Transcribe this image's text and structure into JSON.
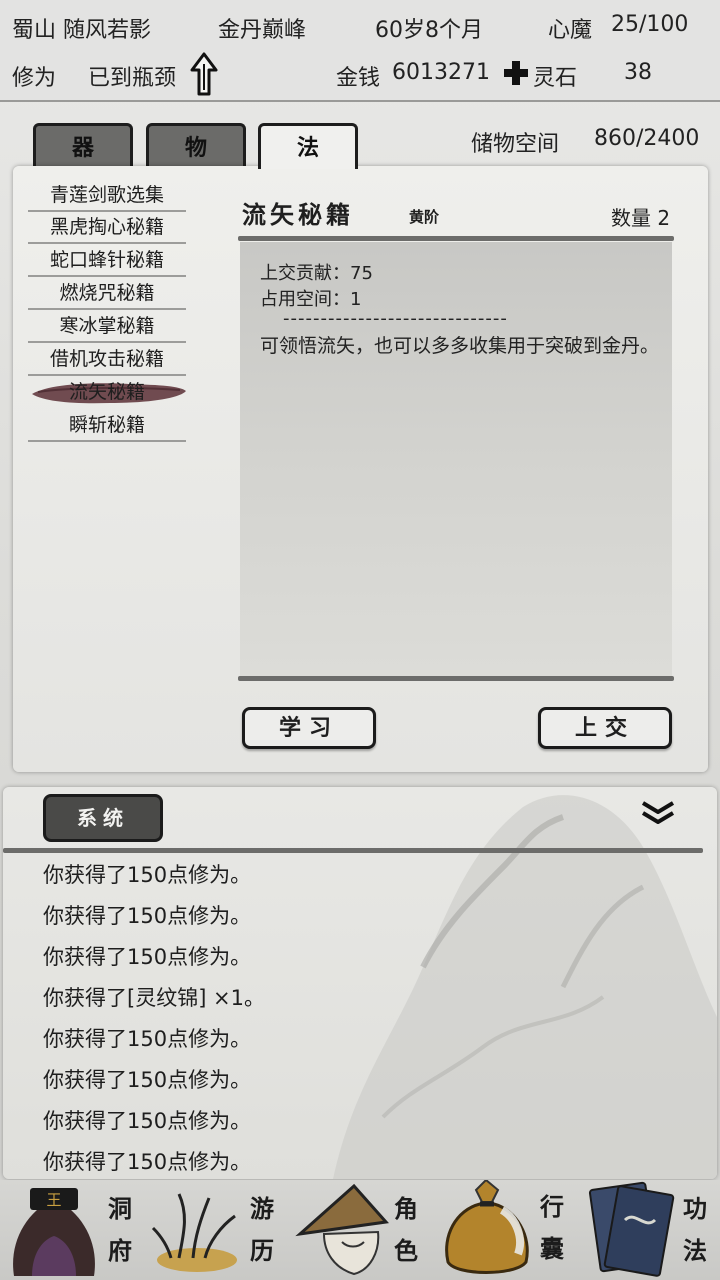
{
  "header": {
    "sect": "蜀山 随风若影",
    "realm": "金丹巅峰",
    "age": "60岁8个月",
    "heart_demon_label": "心魔",
    "heart_demon_value": "25/100",
    "cultivation_label": "修为",
    "cultivation_status": "已到瓶颈",
    "money_label": "金钱",
    "money_value": "6013271",
    "spirit_stone_label": "灵石",
    "spirit_stone_value": "38"
  },
  "tabs": [
    {
      "label": "器",
      "active": false
    },
    {
      "label": "物",
      "active": false
    },
    {
      "label": "法",
      "active": true
    }
  ],
  "storage": {
    "label": "储物空间",
    "value": "860/2400"
  },
  "items": [
    "青莲剑歌选集",
    "黑虎掏心秘籍",
    "蛇口蜂针秘籍",
    "燃烧咒秘籍",
    "寒冰掌秘籍",
    "借机攻击秘籍",
    "流矢秘籍",
    "瞬斩秘籍"
  ],
  "selected_index": 6,
  "detail": {
    "title": "流矢秘籍",
    "grade": "黄阶",
    "count": "数量 2",
    "contribution": "上交贡献：75",
    "space": "占用空间：1",
    "divider": "------------------------------",
    "description": "可领悟流矢，也可以多多收集用于突破到金丹。"
  },
  "buttons": {
    "learn": "学习",
    "submit": "上交"
  },
  "log": {
    "tab_label": "系统",
    "lines": [
      "你获得了150点修为。",
      "你获得了150点修为。",
      "你获得了150点修为。",
      "你获得了[灵纹锦] ×1。",
      "你获得了150点修为。",
      "你获得了150点修为。",
      "你获得了150点修为。",
      "你获得了150点修为。"
    ]
  },
  "nav": [
    {
      "label_top": "洞",
      "label_bottom": "府",
      "icon": "cave-mansion-icon"
    },
    {
      "label_top": "游",
      "label_bottom": "历",
      "icon": "travel-icon"
    },
    {
      "label_top": "角",
      "label_bottom": "色",
      "icon": "character-icon"
    },
    {
      "label_top": "行",
      "label_bottom": "囊",
      "icon": "bag-icon"
    },
    {
      "label_top": "功",
      "label_bottom": "法",
      "icon": "technique-book-icon"
    }
  ],
  "colors": {
    "panel": "#efefec",
    "ink": "#1d1d1d",
    "selected_brush": "#5a2f35",
    "bag_gold": "#b3842c"
  }
}
